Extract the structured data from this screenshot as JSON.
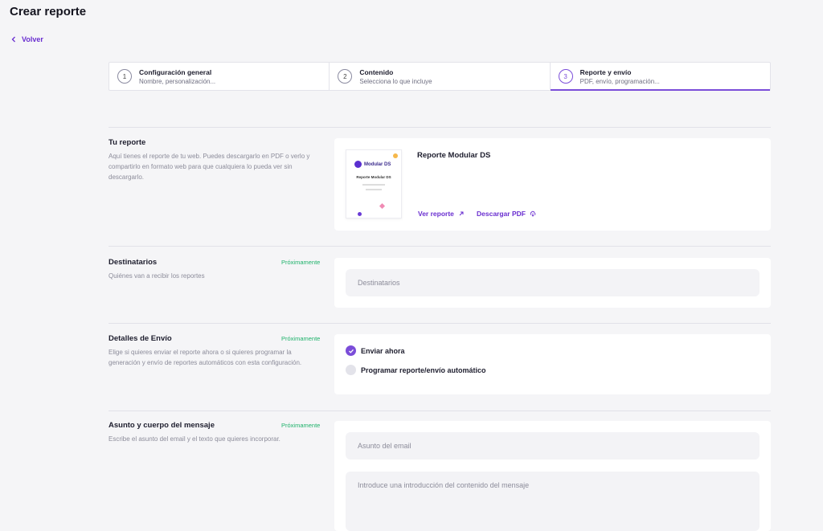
{
  "header": {
    "title": "Crear reporte",
    "back_label": "Volver"
  },
  "steps": [
    {
      "num": "1",
      "title": "Configuración general",
      "sub": "Nombre, personalización..."
    },
    {
      "num": "2",
      "title": "Contenido",
      "sub": "Selecciona lo que incluye"
    },
    {
      "num": "3",
      "title": "Reporte y envío",
      "sub": "PDF, envío, programación..."
    }
  ],
  "report": {
    "title": "Tu reporte",
    "desc": "Aquí tienes el reporte de tu web. Puedes descargarlo en PDF o verlo y compartirlo en formato web para que cualquiera lo pueda ver sin descargarlo.",
    "name": "Reporte Modular DS",
    "thumb_logo": "Modular DS",
    "thumb_title": "Reporte Modular DS",
    "view_label": "Ver reporte",
    "download_label": "Descargar PDF"
  },
  "recipients": {
    "title": "Destinatarios",
    "badge": "Próximamente",
    "desc": "Quiénes van a recibir los reportes",
    "placeholder": "Destinatarios"
  },
  "shipping": {
    "title": "Detalles de Envío",
    "badge": "Próximamente",
    "desc": "Elige si quieres enviar el reporte ahora o si quieres programar la generación y envío de reportes automáticos con esta configuración.",
    "option_now": "Enviar ahora",
    "option_schedule": "Programar reporte/envío automático",
    "selected": "Enviar ahora"
  },
  "message": {
    "title": "Asunto y cuerpo del mensaje",
    "badge": "Próximamente",
    "desc": "Escribe el asunto del email y el texto que quieres incorporar.",
    "subject_placeholder": "Asunto del email",
    "body_placeholder": "Introduce una introducción del contenido del mensaje"
  },
  "colors": {
    "accent": "#7b4dd9",
    "link": "#6a2fd0",
    "soon": "#1fb26b",
    "background": "#f5f5f7"
  }
}
